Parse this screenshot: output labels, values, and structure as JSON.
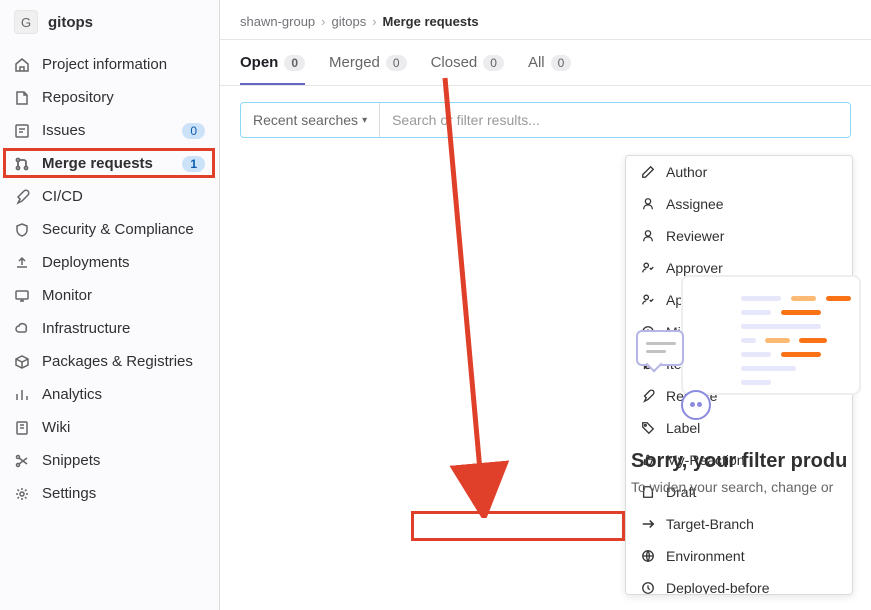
{
  "project": {
    "avatar_letter": "G",
    "name": "gitops"
  },
  "sidebar": {
    "items": [
      {
        "label": "Project information",
        "badge": null
      },
      {
        "label": "Repository",
        "badge": null
      },
      {
        "label": "Issues",
        "badge": "0"
      },
      {
        "label": "Merge requests",
        "badge": "1"
      },
      {
        "label": "CI/CD",
        "badge": null
      },
      {
        "label": "Security & Compliance",
        "badge": null
      },
      {
        "label": "Deployments",
        "badge": null
      },
      {
        "label": "Monitor",
        "badge": null
      },
      {
        "label": "Infrastructure",
        "badge": null
      },
      {
        "label": "Packages & Registries",
        "badge": null
      },
      {
        "label": "Analytics",
        "badge": null
      },
      {
        "label": "Wiki",
        "badge": null
      },
      {
        "label": "Snippets",
        "badge": null
      },
      {
        "label": "Settings",
        "badge": null
      }
    ]
  },
  "breadcrumb": {
    "group": "shawn-group",
    "project": "gitops",
    "page": "Merge requests"
  },
  "tabs": [
    {
      "label": "Open",
      "count": "0"
    },
    {
      "label": "Merged",
      "count": "0"
    },
    {
      "label": "Closed",
      "count": "0"
    },
    {
      "label": "All",
      "count": "0"
    }
  ],
  "search": {
    "recent_label": "Recent searches",
    "placeholder": "Search or filter results..."
  },
  "filter_dropdown": [
    "Author",
    "Assignee",
    "Reviewer",
    "Approver",
    "Approved-By",
    "Milestone",
    "Iteration",
    "Release",
    "Label",
    "My-Reaction",
    "Draft",
    "Target-Branch",
    "Environment",
    "Deployed-before"
  ],
  "empty_state": {
    "title": "Sorry, your filter produ",
    "subtitle": "To widen your search, change or"
  }
}
